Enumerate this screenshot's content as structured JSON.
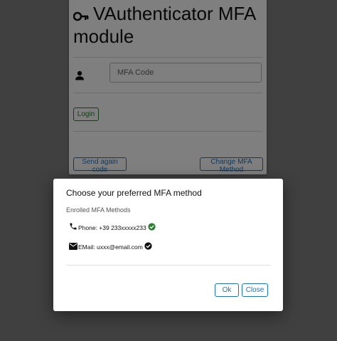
{
  "colors": {
    "overlay": "#808080",
    "primary": "#1e73be",
    "login": "#2e7d32",
    "verified": "#2e7d32",
    "default_check": "#111111"
  },
  "card": {
    "title": "VAuthenticator MFA module",
    "title_icon": "key-icon",
    "user_icon": "person-icon",
    "mfa_code_placeholder": "MFA Code",
    "login_label": "Login",
    "send_again_label": "Send again code",
    "change_method_label": "Change MFA Method"
  },
  "dialog": {
    "title": "Choose your preferred MFA method",
    "section_label": "Enrolled MFA Methods",
    "methods": [
      {
        "icon": "phone-icon",
        "label": "Phone: +39 233xxxxx233",
        "status_icon": "verified-check-icon"
      },
      {
        "icon": "email-icon",
        "label": "EMail: uxxx@email.com",
        "status_icon": "check-circle-icon"
      }
    ],
    "ok_label": "Ok",
    "close_label": "Close"
  }
}
